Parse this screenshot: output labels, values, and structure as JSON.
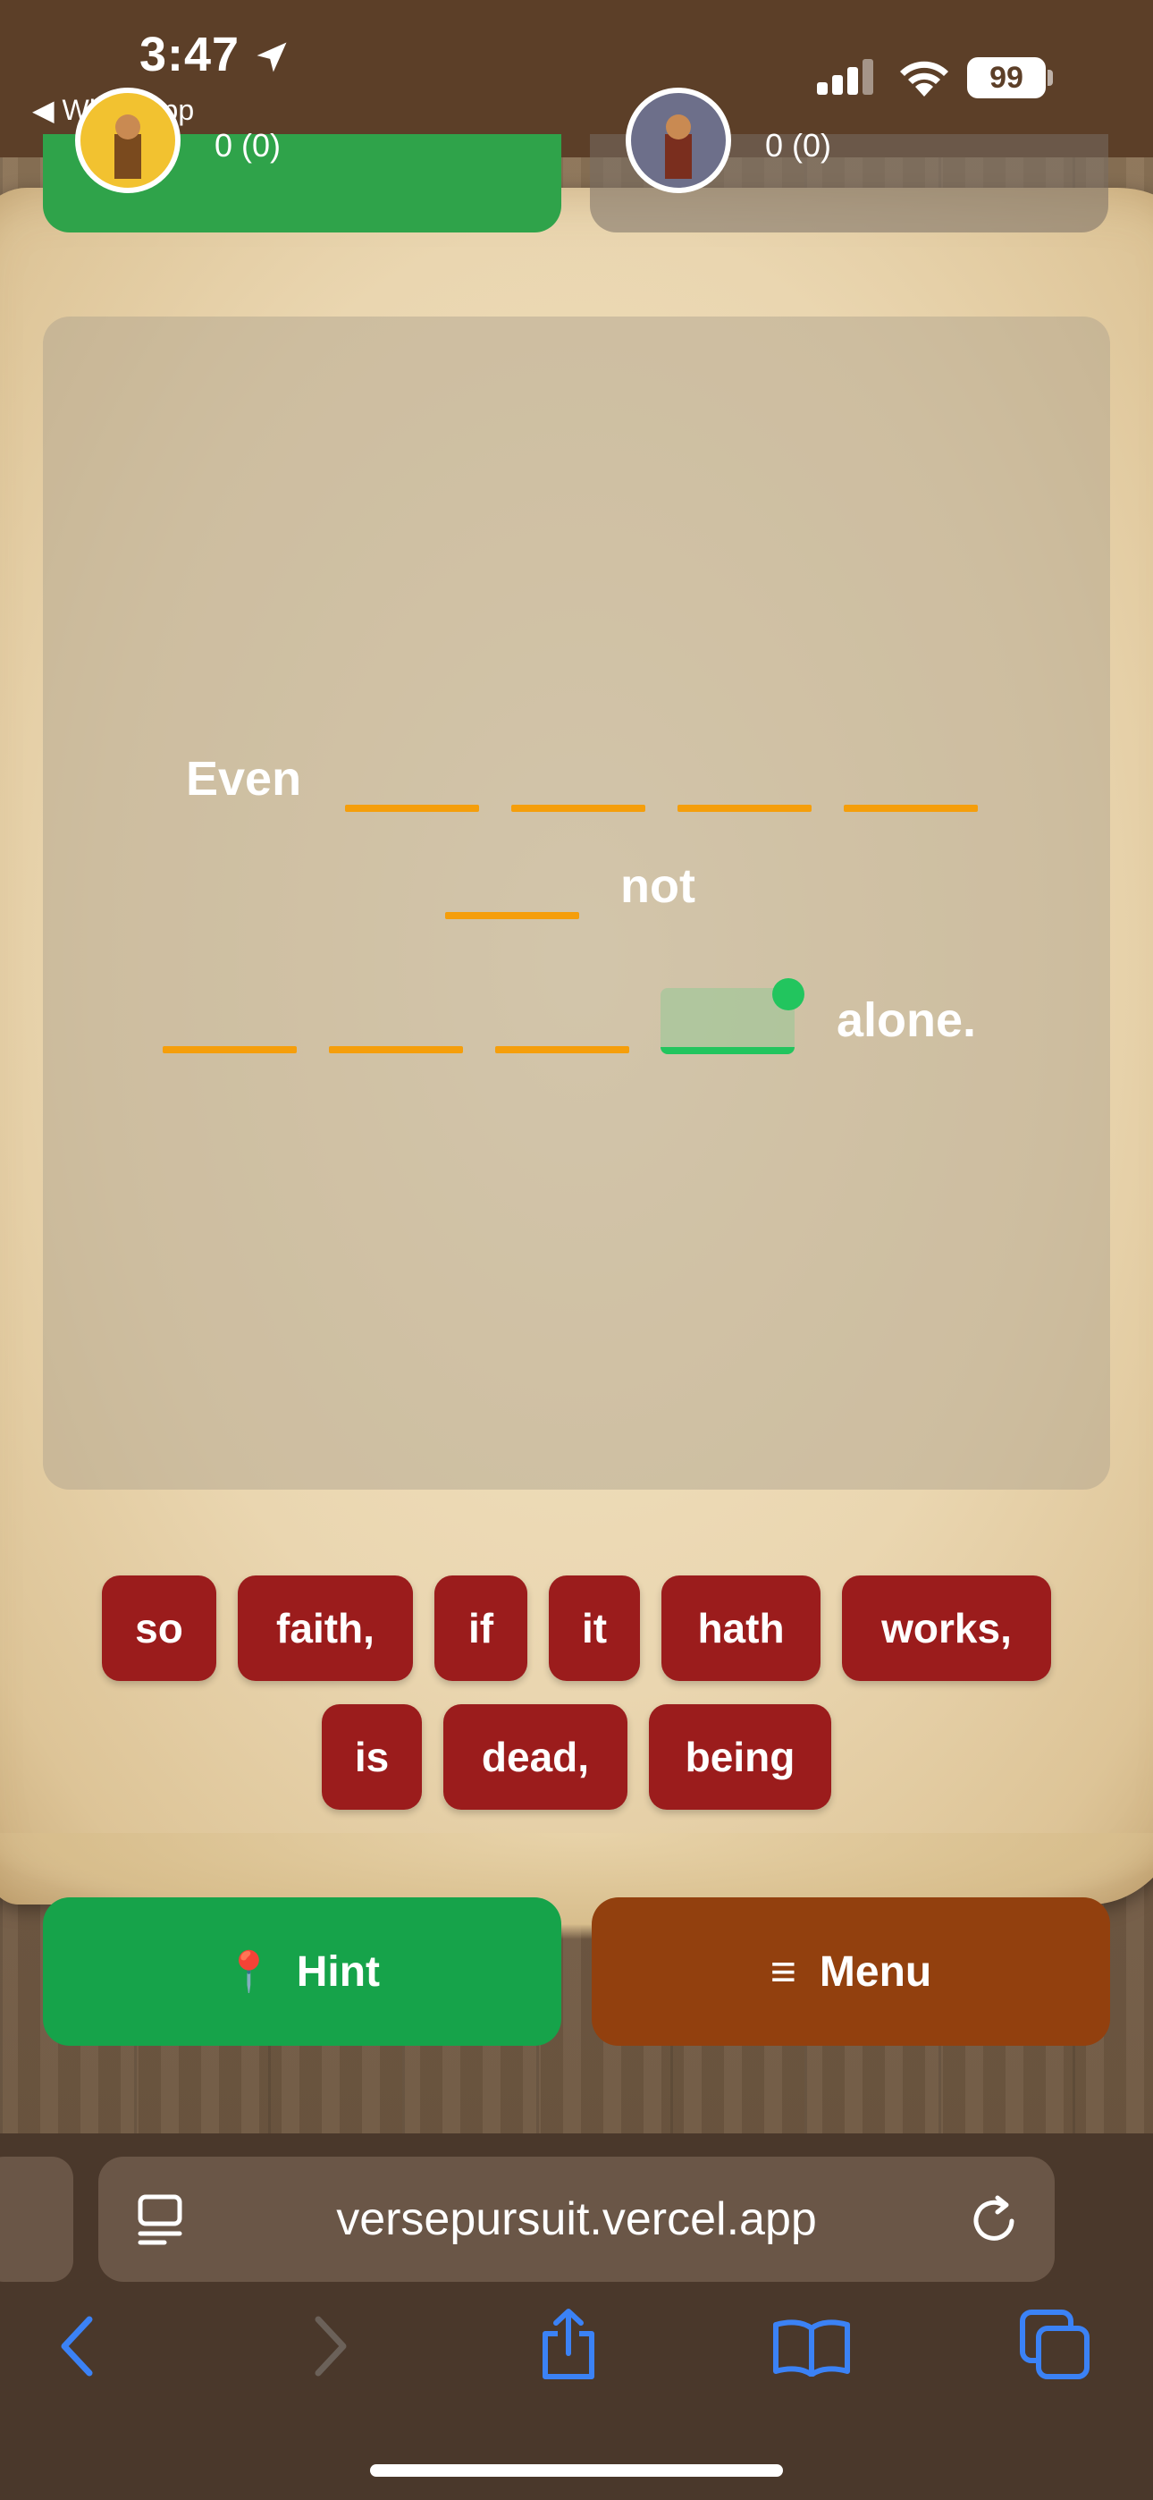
{
  "status_bar": {
    "time": "3:47",
    "back_app": "◀ WhatsApp",
    "battery": "99"
  },
  "players": [
    {
      "score": "0 (0)",
      "color": "#2fa34a"
    },
    {
      "score": "0 (0)",
      "color": "#786e64"
    }
  ],
  "verse": {
    "words": [
      "Even",
      "not",
      "alone."
    ],
    "blank_color": "#f59e0b",
    "active_color": "#22c55e"
  },
  "word_bank": [
    "so",
    "faith,",
    "if",
    "it",
    "hath",
    "works,",
    "is",
    "dead,",
    "being"
  ],
  "actions": {
    "hint_icon": "📍",
    "hint_label": "Hint",
    "menu_icon": "≡",
    "menu_label": "Menu"
  },
  "browser": {
    "url": "versepursuit.vercel.app"
  },
  "colors": {
    "chip": "#9b1c1c",
    "hint": "#16a34a",
    "menu": "#92400e"
  }
}
